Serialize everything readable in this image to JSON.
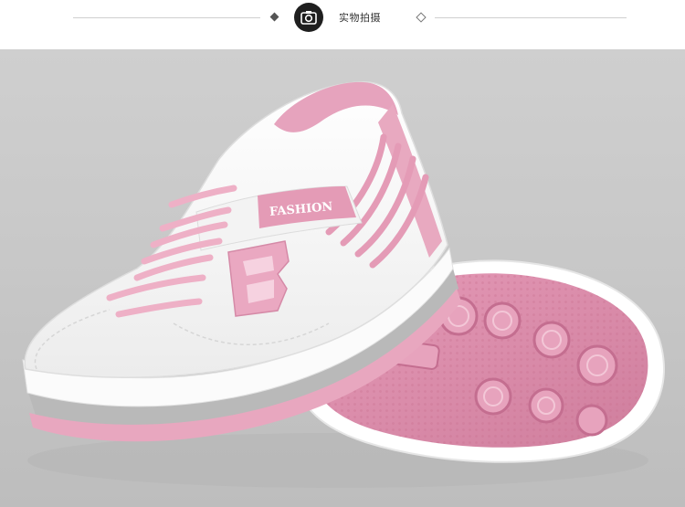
{
  "header": {
    "title": "实物拍摄",
    "camera_icon": "camera-icon"
  },
  "photo": {
    "shoe_text": "FASHION",
    "colors": {
      "background": "#c9c9c9",
      "upper": "#f7f7f7",
      "pink": "#e8a9c0",
      "pink_dark": "#cf7f9e",
      "sole_pink": "#d98aa8"
    }
  }
}
